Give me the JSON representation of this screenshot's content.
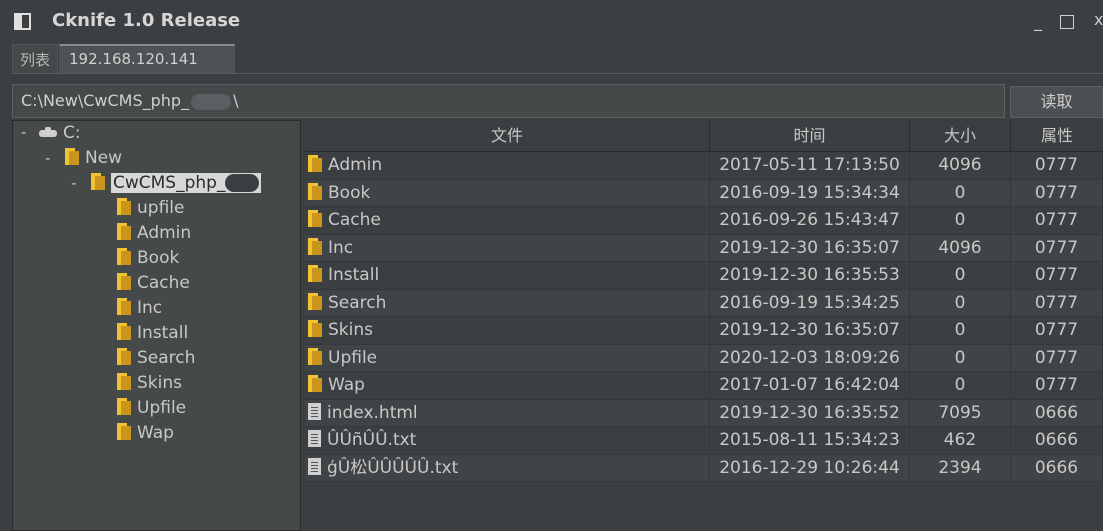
{
  "window": {
    "title": "Cknife 1.0 Release",
    "minimize": "_",
    "close": "x"
  },
  "tabs": [
    {
      "label": "列表"
    },
    {
      "label": "192.168.120.141"
    }
  ],
  "path": {
    "value": "C:\\New\\CwCMS_php_",
    "trailing": "\\"
  },
  "read_button": "读取",
  "tree": {
    "drive": "C:",
    "new": "New",
    "cwcms": "CwCMS_php_",
    "children": [
      "upfile",
      "Admin",
      "Book",
      "Cache",
      "Inc",
      "Install",
      "Search",
      "Skins",
      "Upfile",
      "Wap"
    ],
    "toggle": "-"
  },
  "table": {
    "headers": {
      "name": "文件",
      "time": "时间",
      "size": "大小",
      "perm": "属性"
    },
    "rows": [
      {
        "type": "folder",
        "name": "Admin",
        "time": "2017-05-11 17:13:50",
        "size": "4096",
        "perm": "0777"
      },
      {
        "type": "folder",
        "name": "Book",
        "time": "2016-09-19 15:34:34",
        "size": "0",
        "perm": "0777"
      },
      {
        "type": "folder",
        "name": "Cache",
        "time": "2016-09-26 15:43:47",
        "size": "0",
        "perm": "0777"
      },
      {
        "type": "folder",
        "name": "Inc",
        "time": "2019-12-30 16:35:07",
        "size": "4096",
        "perm": "0777"
      },
      {
        "type": "folder",
        "name": "Install",
        "time": "2019-12-30 16:35:53",
        "size": "0",
        "perm": "0777"
      },
      {
        "type": "folder",
        "name": "Search",
        "time": "2016-09-19 15:34:25",
        "size": "0",
        "perm": "0777"
      },
      {
        "type": "folder",
        "name": "Skins",
        "time": "2019-12-30 16:35:07",
        "size": "0",
        "perm": "0777"
      },
      {
        "type": "folder",
        "name": "Upfile",
        "time": "2020-12-03 18:09:26",
        "size": "0",
        "perm": "0777"
      },
      {
        "type": "folder",
        "name": "Wap",
        "time": "2017-01-07 16:42:04",
        "size": "0",
        "perm": "0777"
      },
      {
        "type": "file",
        "name": "index.html",
        "time": "2019-12-30 16:35:52",
        "size": "7095",
        "perm": "0666"
      },
      {
        "type": "file",
        "name": "ÛÛñÛÛ.txt",
        "time": "2015-08-11 15:34:23",
        "size": "462",
        "perm": "0666"
      },
      {
        "type": "file",
        "name": "ģÛ松ÛÛÛÛÛ.txt",
        "time": "2016-12-29 10:26:44",
        "size": "2394",
        "perm": "0666"
      }
    ]
  }
}
